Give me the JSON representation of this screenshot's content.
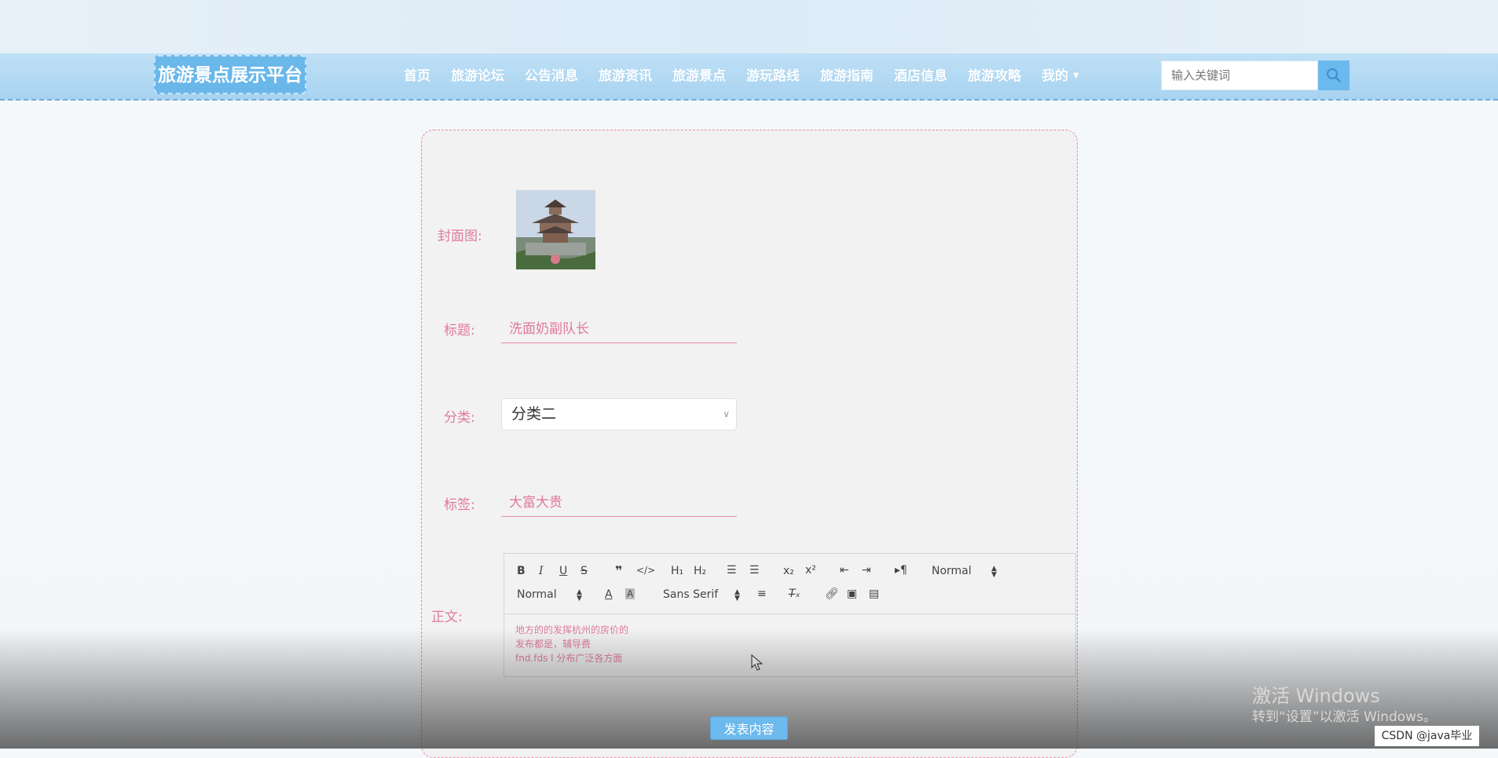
{
  "header": {
    "logo_text": "旅游景点展示平台",
    "nav_items": [
      {
        "label": "首页"
      },
      {
        "label": "旅游论坛"
      },
      {
        "label": "公告消息"
      },
      {
        "label": "旅游资讯"
      },
      {
        "label": "旅游景点"
      },
      {
        "label": "游玩路线"
      },
      {
        "label": "旅游指南"
      },
      {
        "label": "酒店信息"
      },
      {
        "label": "旅游攻略"
      },
      {
        "label": "我的"
      }
    ],
    "search": {
      "placeholder": "输入关键词"
    }
  },
  "form": {
    "cover_label": "封面图:",
    "title_label": "标题:",
    "title_value": "洗面奶副队长",
    "category_label": "分类:",
    "category_value": "分类二",
    "tags_label": "标签:",
    "tags_value": "大富大贵",
    "content_label": "正文:",
    "editor": {
      "header_picker": "Normal",
      "size_picker": "Normal",
      "font_picker": "Sans Serif",
      "content_lines": [
        "地方的的发挥杭州的房价的",
        "发布都是，辅导费",
        "fnd.fds l 分布广泛各方面"
      ]
    },
    "submit_label": "发表内容"
  },
  "overlay": {
    "activate_title": "激活 Windows",
    "activate_sub": "转到“设置”以激活 Windows。",
    "watermark": "CSDN @java毕业"
  },
  "colors": {
    "accent": "#6cb9ee",
    "label_pink": "#e0799c",
    "nav_bg": "#a8d3f0"
  }
}
